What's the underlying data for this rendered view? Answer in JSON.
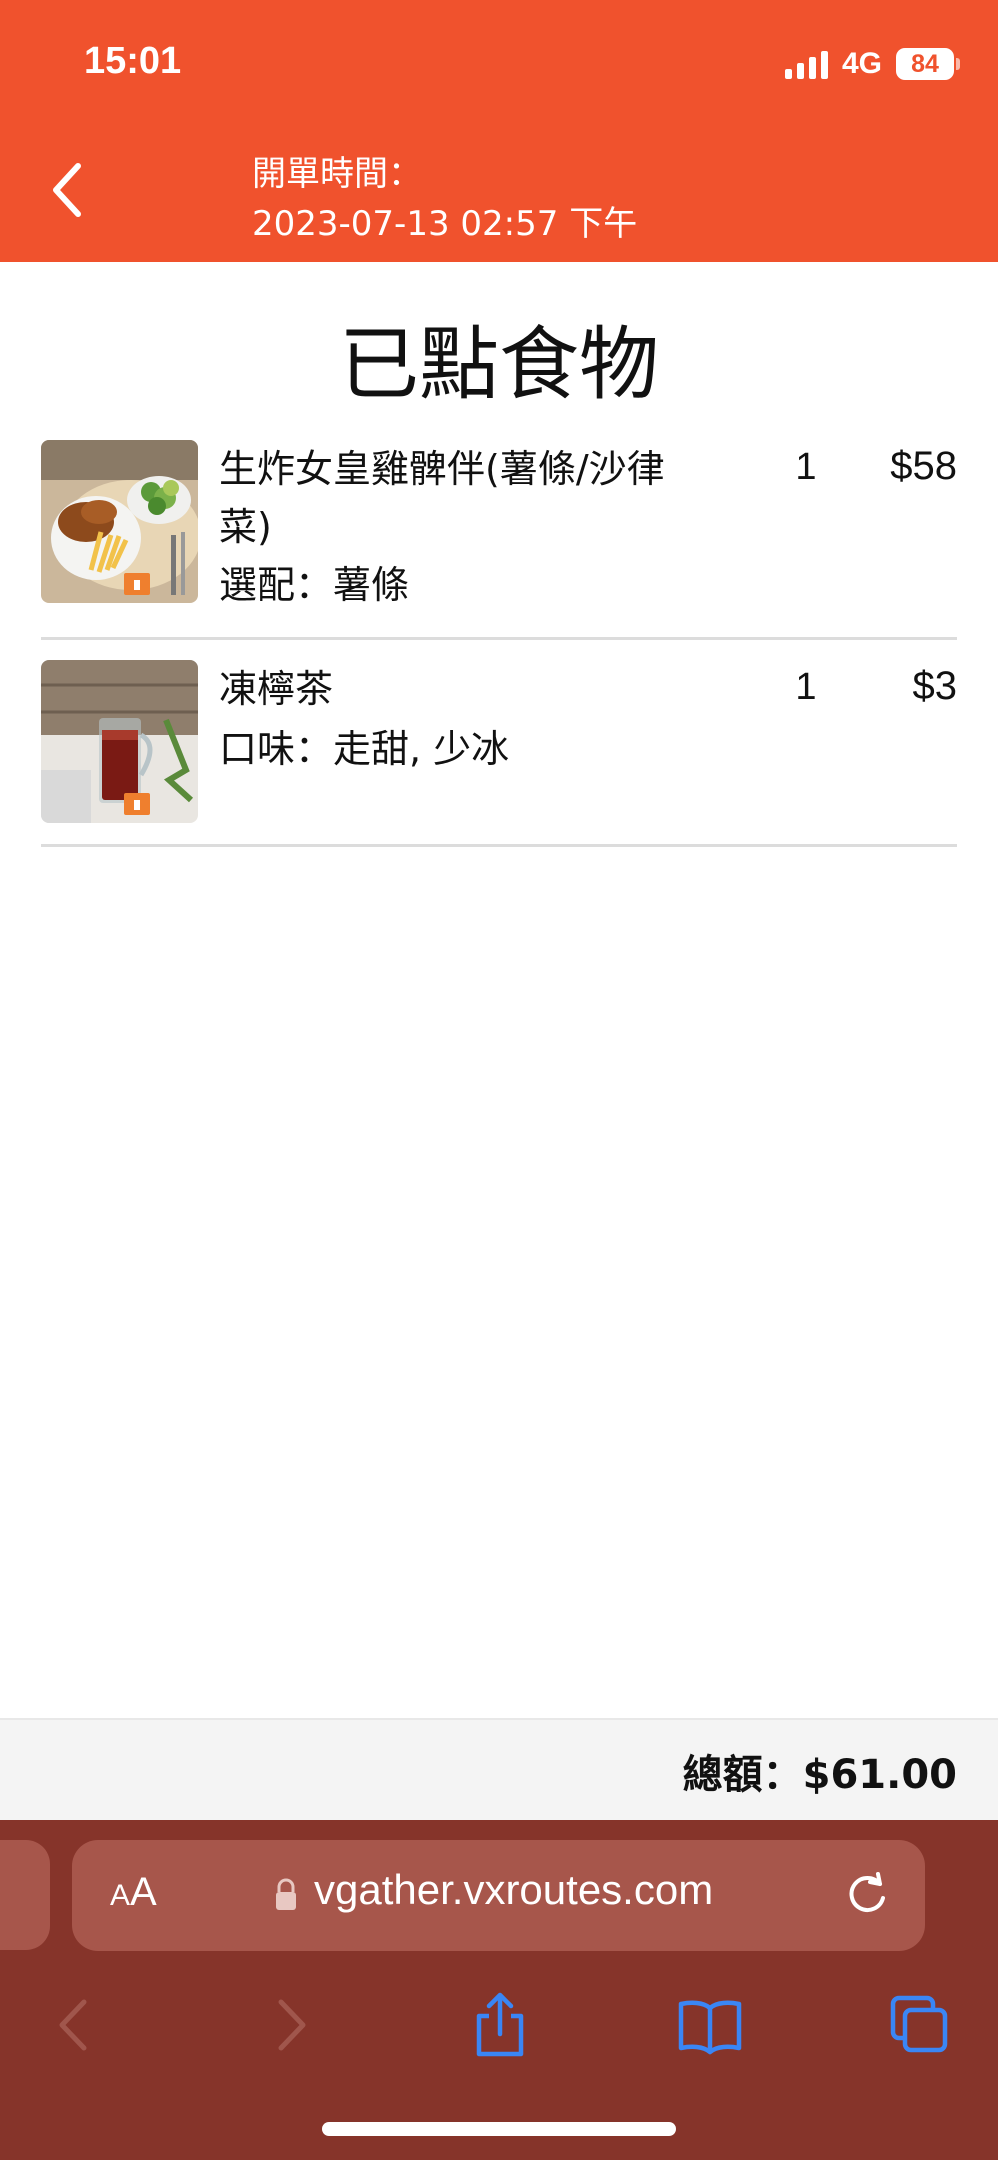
{
  "status_bar": {
    "time": "15:01",
    "network": "4G",
    "battery": "84"
  },
  "header": {
    "order_time_label": "開單時間：",
    "order_time_value": "2023-07-13 02:57 下午",
    "back_icon": "chevron-left-icon"
  },
  "page": {
    "title": "已點食物"
  },
  "items": [
    {
      "name": "生炸女皇雞髀伴(薯條/沙律菜)",
      "option": "選配：薯條",
      "qty": "1",
      "price": "$58"
    },
    {
      "name": "凍檸茶",
      "option": "口味：走甜, 少冰",
      "qty": "1",
      "price": "$3"
    }
  ],
  "footer": {
    "total": "總額：$61.00"
  },
  "browser": {
    "aa_small": "A",
    "aa_big": "A",
    "url": "vgather.vxroutes.com",
    "icons": [
      "lock-icon",
      "reload-icon",
      "back-arrow-icon",
      "forward-arrow-icon",
      "share-icon",
      "bookmarks-icon",
      "tabs-icon"
    ]
  },
  "colors": {
    "header": "#f0522d",
    "browser_chrome": "#86342a",
    "browser_blue": "#3a86f5"
  }
}
